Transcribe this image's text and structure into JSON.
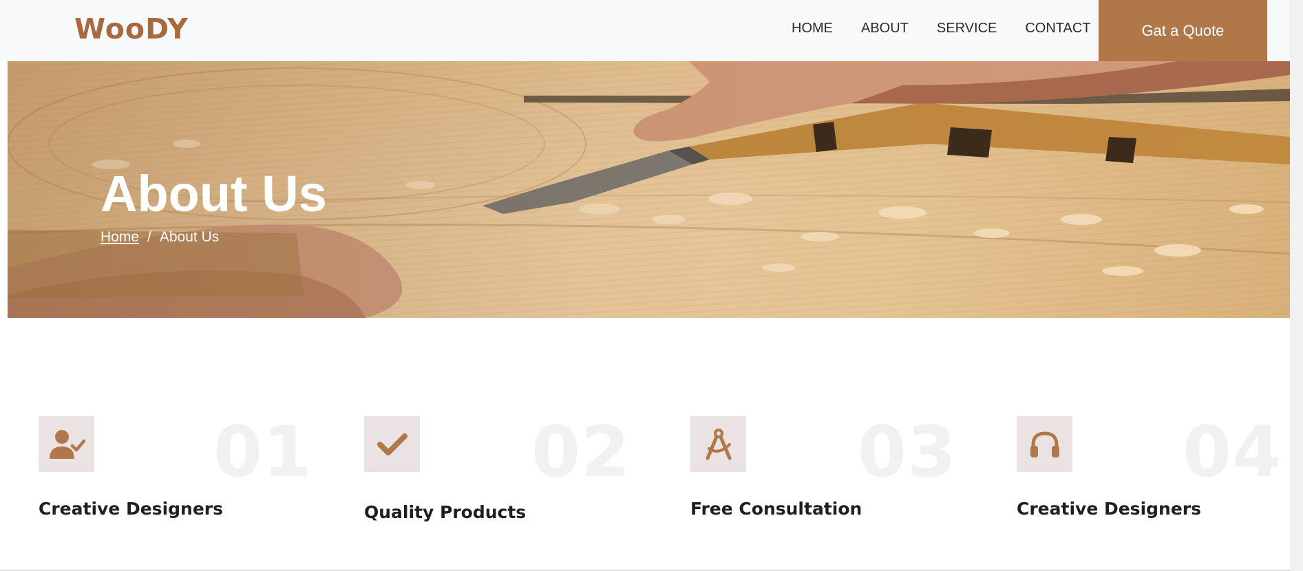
{
  "brand": {
    "name": "WooDY",
    "color": "#a8693e"
  },
  "nav": {
    "links": [
      "HOME",
      "ABOUT",
      "SERVICE",
      "CONTACT"
    ],
    "cta_label": "Gat a Quote"
  },
  "hero": {
    "title": "About Us",
    "breadcrumb": {
      "home": "Home",
      "separator": "/",
      "current": "About Us"
    }
  },
  "features": [
    {
      "icon": "user-check-icon",
      "number": "01",
      "title": "Creative Designers"
    },
    {
      "icon": "check-icon",
      "number": "02",
      "title": "Quality Products"
    },
    {
      "icon": "drafting-compass-icon",
      "number": "03",
      "title": "Free Consultation"
    },
    {
      "icon": "headphones-icon",
      "number": "04",
      "title": "Creative Designers"
    }
  ],
  "colors": {
    "accent": "#b07849",
    "icon_bg": "#ebe3e3",
    "navbar_bg": "#f8f9fa"
  }
}
